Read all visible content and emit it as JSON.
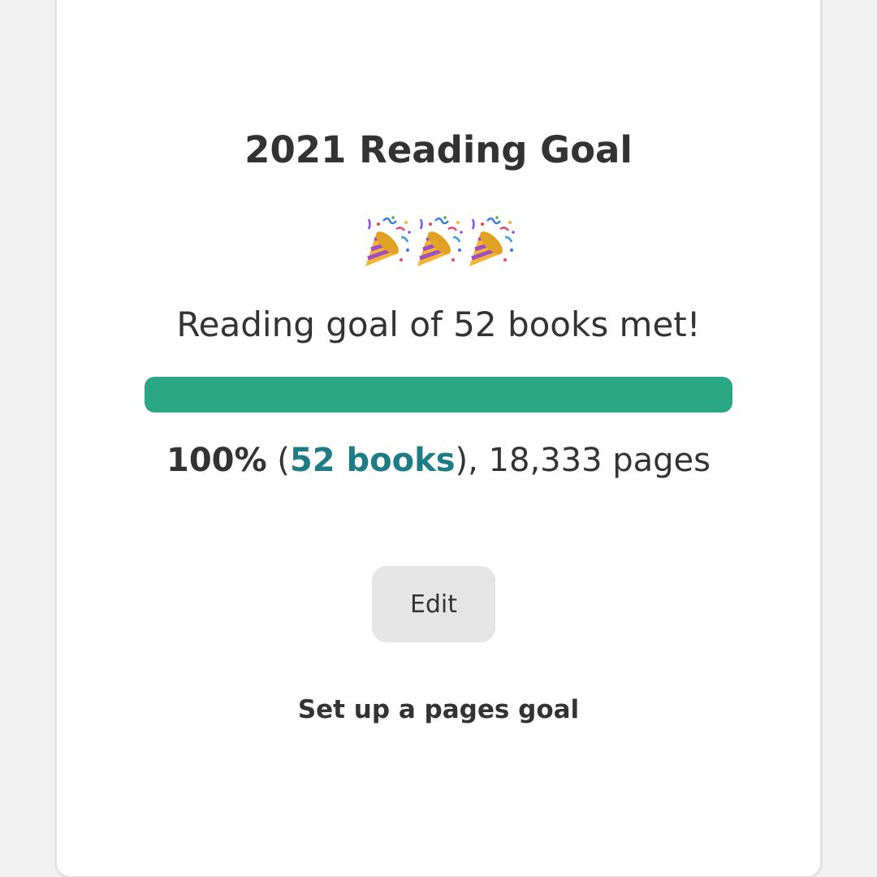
{
  "goal": {
    "title": "2021 Reading Goal",
    "celebration_icons": [
      "party-popper-icon",
      "party-popper-icon",
      "party-popper-icon"
    ],
    "status_text": "Reading goal of 52 books met!",
    "progress_percent": 100,
    "progress_color": "#2aa882",
    "stats": {
      "percent_text": "100%",
      "open_paren": " (",
      "books_link_text": "52 books",
      "rest_text": "), 18,333 pages",
      "link_color": "#1e7c84"
    },
    "edit_button_label": "Edit",
    "pages_goal_link_text": "Set up a pages goal"
  }
}
